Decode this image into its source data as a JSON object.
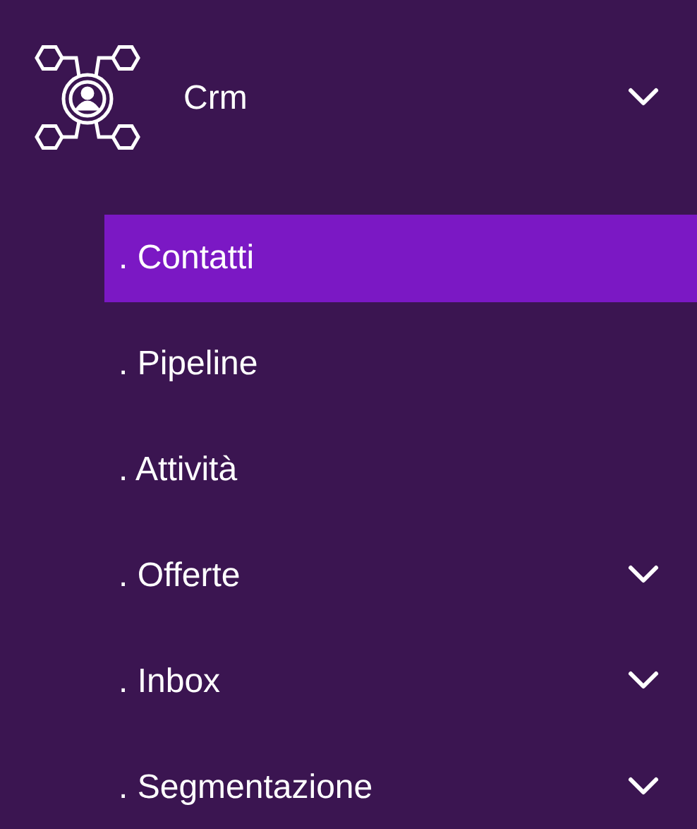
{
  "header": {
    "label": "Crm",
    "expanded": true
  },
  "items": [
    {
      "label": ". Contatti",
      "selected": true,
      "kind": "link"
    },
    {
      "label": ". Pipeline",
      "selected": false,
      "kind": "link"
    },
    {
      "label": ". Attività",
      "selected": false,
      "kind": "link"
    },
    {
      "label": ". Offerte",
      "selected": false,
      "kind": "group"
    },
    {
      "label": ". Inbox",
      "selected": false,
      "kind": "group"
    },
    {
      "label": ". Segmentazione",
      "selected": false,
      "kind": "group"
    }
  ]
}
